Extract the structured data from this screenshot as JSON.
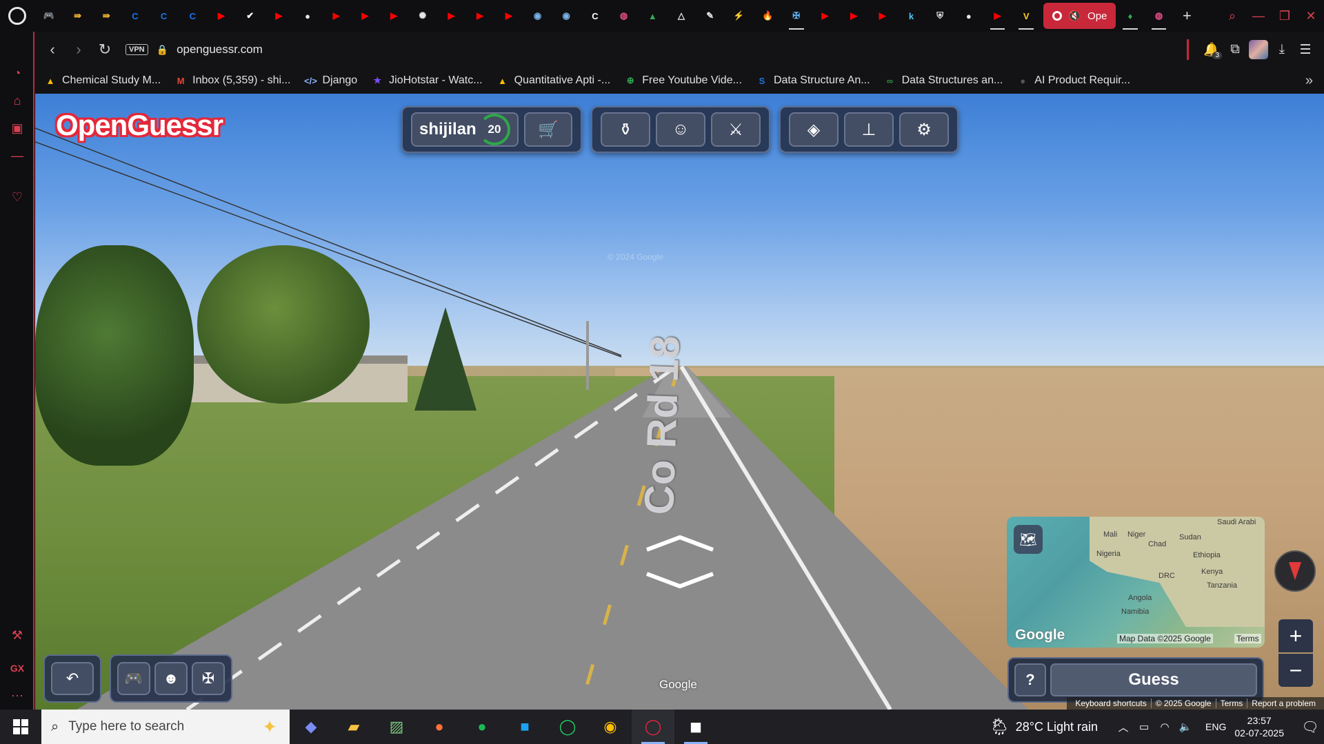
{
  "browser": {
    "tabs": [
      {
        "icon": "gamepad-icon",
        "glyph": "🎮",
        "color": "#d0d0d0"
      },
      {
        "icon": "code-arrow-icon",
        "glyph": "⇛",
        "color": "#f2b233"
      },
      {
        "icon": "code-arrow-icon",
        "glyph": "⇛",
        "color": "#f2b233"
      },
      {
        "icon": "c-logo-icon",
        "glyph": "C",
        "color": "#1a73e8"
      },
      {
        "icon": "c-logo-icon",
        "glyph": "C",
        "color": "#1a73e8"
      },
      {
        "icon": "c-logo-icon",
        "glyph": "C",
        "color": "#1a73e8"
      },
      {
        "icon": "youtube-icon",
        "glyph": "▶",
        "color": "#ff0000"
      },
      {
        "icon": "checkmark-icon",
        "glyph": "✔",
        "color": "#ffffff"
      },
      {
        "icon": "youtube-icon",
        "glyph": "▶",
        "color": "#ff0000"
      },
      {
        "icon": "github-icon",
        "glyph": "●",
        "color": "#e6e6e6"
      },
      {
        "icon": "youtube-icon",
        "glyph": "▶",
        "color": "#ff0000"
      },
      {
        "icon": "youtube-icon",
        "glyph": "▶",
        "color": "#ff0000"
      },
      {
        "icon": "youtube-icon",
        "glyph": "▶",
        "color": "#ff0000"
      },
      {
        "icon": "openai-icon",
        "glyph": "✺",
        "color": "#e6e6e6"
      },
      {
        "icon": "youtube-icon",
        "glyph": "▶",
        "color": "#ff0000"
      },
      {
        "icon": "youtube-icon",
        "glyph": "▶",
        "color": "#ff0000"
      },
      {
        "icon": "youtube-icon",
        "glyph": "▶",
        "color": "#ff0000"
      },
      {
        "icon": "eye-icon",
        "glyph": "◉",
        "color": "#7ab3e8"
      },
      {
        "icon": "eye-icon",
        "glyph": "◉",
        "color": "#7ab3e8"
      },
      {
        "icon": "c-logo-icon",
        "glyph": "C",
        "color": "#ffffff"
      },
      {
        "icon": "dribbble-icon",
        "glyph": "◍",
        "color": "#ea4c89"
      },
      {
        "icon": "google-drive-icon",
        "glyph": "▲",
        "color": "#34a853"
      },
      {
        "icon": "delta-icon",
        "glyph": "△",
        "color": "#e6e6e6"
      },
      {
        "icon": "link-icon",
        "glyph": "✎",
        "color": "#e6e6e6"
      },
      {
        "icon": "bolt-icon",
        "glyph": "⚡",
        "color": "#f4511e"
      },
      {
        "icon": "flame-icon",
        "glyph": "🔥",
        "color": "#ff7043"
      },
      {
        "icon": "butterfly-icon",
        "glyph": "✠",
        "color": "#64b5f6"
      },
      {
        "icon": "youtube-icon",
        "glyph": "▶",
        "color": "#ff0000"
      },
      {
        "icon": "youtube-icon",
        "glyph": "▶",
        "color": "#ff0000"
      },
      {
        "icon": "youtube-icon",
        "glyph": "▶",
        "color": "#ff0000"
      },
      {
        "icon": "k-icon",
        "glyph": "k",
        "color": "#4fc3f7"
      },
      {
        "icon": "shield-icon",
        "glyph": "⛨",
        "color": "#e6e6e6"
      },
      {
        "icon": "github-icon",
        "glyph": "●",
        "color": "#e6e6e6"
      },
      {
        "icon": "youtube-icon",
        "glyph": "▶",
        "color": "#ff0000"
      },
      {
        "icon": "v-logo-icon",
        "glyph": "V",
        "color": "#ffca28"
      }
    ],
    "active_tab_label": "Ope",
    "after_tabs": [
      {
        "icon": "leaf-icon",
        "glyph": "♦",
        "color": "#34a853"
      },
      {
        "icon": "dribbble-icon",
        "glyph": "◍",
        "color": "#ea4c89"
      }
    ],
    "url": "openguessr.com",
    "vpn_label": "VPN",
    "extensions_badge": "3",
    "bookmarks": [
      {
        "icon": "google-drive-icon",
        "glyph": "▲",
        "color": "#fbbc04",
        "label": "Chemical Study M..."
      },
      {
        "icon": "gmail-icon",
        "glyph": "M",
        "color": "#ea4335",
        "label": "Inbox (5,359) - shi..."
      },
      {
        "icon": "code-icon",
        "glyph": "</>",
        "color": "#8ab4f8",
        "label": "Django"
      },
      {
        "icon": "jiohotstar-icon",
        "glyph": "★",
        "color": "#7c4dff",
        "label": "JioHotstar - Watc..."
      },
      {
        "icon": "google-drive-icon",
        "glyph": "▲",
        "color": "#fbbc04",
        "label": "Quantitative Apti -..."
      },
      {
        "icon": "download-circle-icon",
        "glyph": "⊕",
        "color": "#34a853",
        "label": "Free Youtube Vide..."
      },
      {
        "icon": "s-logo-icon",
        "glyph": "S",
        "color": "#1a73e8",
        "label": "Data Structure An..."
      },
      {
        "icon": "gfg-icon",
        "glyph": "∞",
        "color": "#2f8d46",
        "label": "Data Structures an..."
      },
      {
        "icon": "product-icon",
        "glyph": "●",
        "color": "#555555",
        "label": "AI Product Requir..."
      }
    ]
  },
  "game": {
    "logo": "OpenGuessr",
    "username": "shijilan",
    "level": "20",
    "watermark": "© 2024 Google",
    "road_label": "Co Rd 18",
    "google_mark": "Google",
    "minimap": {
      "labels": [
        {
          "text": "Saudi Arabi",
          "cls": "l1"
        },
        {
          "text": "Mali",
          "cls": "l2"
        },
        {
          "text": "Niger",
          "cls": "l3"
        },
        {
          "text": "Sudan",
          "cls": "l4"
        },
        {
          "text": "Chad",
          "cls": "l5"
        },
        {
          "text": "Nigeria",
          "cls": "l6"
        },
        {
          "text": "Ethiopia",
          "cls": "l7"
        },
        {
          "text": "Kenya",
          "cls": "l8"
        },
        {
          "text": "DRC",
          "cls": "l9"
        },
        {
          "text": "Tanzania",
          "cls": "l10"
        },
        {
          "text": "Angola",
          "cls": "l11"
        },
        {
          "text": "Namibia",
          "cls": "l12"
        }
      ],
      "google": "Google",
      "map_data": "Map Data ©2025 Google",
      "terms": "Terms"
    },
    "help_label": "?",
    "guess_label": "Guess",
    "footer": [
      "Keyboard shortcuts",
      "© 2025 Google",
      "Terms",
      "Report a problem"
    ]
  },
  "taskbar": {
    "search_placeholder": "Type here to search",
    "weather": "28°C  Light rain",
    "lang": "ENG",
    "time": "23:57",
    "date": "02-07-2025"
  }
}
